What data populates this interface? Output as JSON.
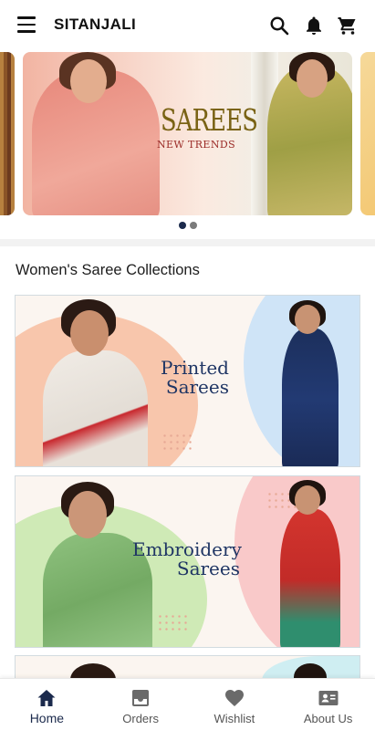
{
  "app": {
    "title": "SITANJALI"
  },
  "appbar": {
    "icons": [
      "menu-icon",
      "search-icon",
      "bell-icon",
      "cart-icon"
    ]
  },
  "carousel": {
    "slide_title": "SAREES",
    "slide_subtitle": "NEW TRENDS",
    "slide_count": 2,
    "active_slide": 1
  },
  "section": {
    "title": "Women's Saree Collections"
  },
  "collections": [
    {
      "line1": "Printed",
      "line2": "Sarees"
    },
    {
      "line1": "Embroidery",
      "line2": "Sarees"
    }
  ],
  "bottom_nav": [
    {
      "label": "Home",
      "icon": "home-icon",
      "active": true
    },
    {
      "label": "Orders",
      "icon": "inbox-icon",
      "active": false
    },
    {
      "label": "Wishlist",
      "icon": "heart-icon",
      "active": false
    },
    {
      "label": "About Us",
      "icon": "contact-card-icon",
      "active": false
    }
  ],
  "colors": {
    "accent": "#1b2a4c",
    "banner_title": "#7a6315",
    "banner_subtitle": "#9b2b27",
    "collection_text": "#1f3564"
  }
}
